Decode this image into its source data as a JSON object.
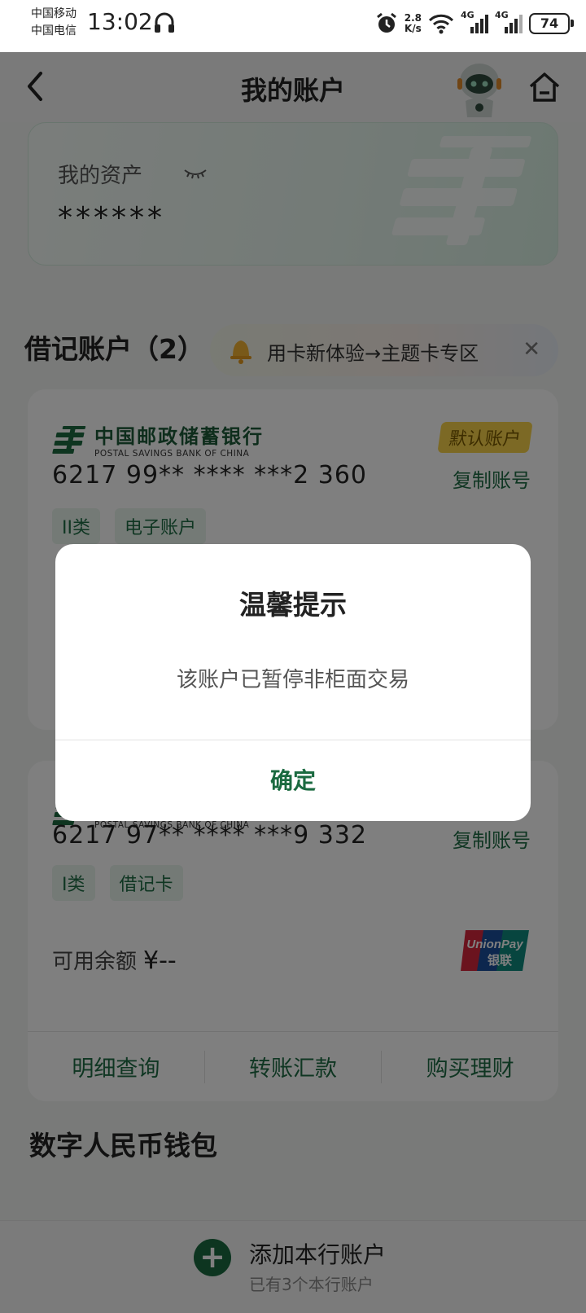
{
  "status_bar": {
    "carrier_1": "中国移动",
    "carrier_2": "中国电信",
    "time": "13:02",
    "speed_value": "2.8",
    "speed_unit": "K/s",
    "network_1": "4G",
    "network_2": "4G",
    "battery": "74"
  },
  "nav": {
    "title": "我的账户"
  },
  "asset_card": {
    "label": "我的资产",
    "value": "******"
  },
  "debit_section": {
    "title": "借记账户（2）",
    "promo_text": "用卡新体验→主题卡专区",
    "promo_close": "✕"
  },
  "bank": {
    "name_cn": "中国邮政储蓄银行",
    "name_en": "POSTAL SAVINGS BANK OF CHINA"
  },
  "accounts": [
    {
      "badge": "默认账户",
      "number": "6217 99** **** ***2 360",
      "copy_label": "复制账号",
      "tags": [
        "II类",
        "电子账户"
      ]
    },
    {
      "number": "6217 97** **** ***9 332",
      "copy_label": "复制账号",
      "tags": [
        "I类",
        "借记卡"
      ],
      "balance_label": "可用余额",
      "balance_value": "¥--",
      "card_brand_en": "UnionPay",
      "card_brand_cn": "银联",
      "actions": [
        "明细查询",
        "转账汇款",
        "购买理财"
      ]
    }
  ],
  "digital_section": {
    "title": "数字人民币钱包"
  },
  "bottom_bar": {
    "title": "添加本行账户",
    "subtitle": "已有3个本行账户",
    "icon_text": "+"
  },
  "dialog": {
    "title": "温馨提示",
    "message": "该账户已暂停非柜面交易",
    "confirm": "确定"
  },
  "colors": {
    "brand_green": "#1b6a40",
    "badge_yellow": "#f8d34a"
  }
}
